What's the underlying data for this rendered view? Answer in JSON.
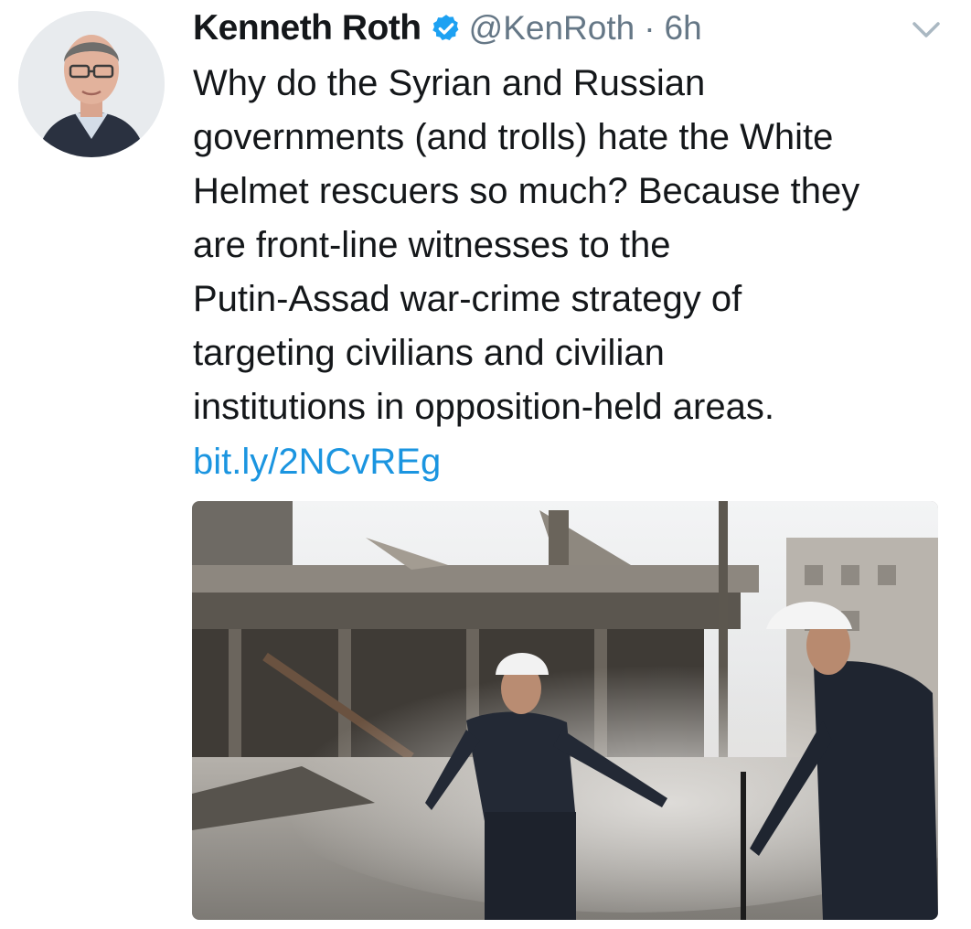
{
  "tweet": {
    "author_name": "Kenneth Roth",
    "handle": "@KenRoth",
    "separator": "·",
    "time": "6h",
    "verified": true,
    "text_lines": [
      "Why do the Syrian and Russian",
      "governments (and trolls) hate the White",
      "Helmet rescuers so much? Because they",
      "are front-line witnesses to the",
      "Putin-Assad war-crime strategy of",
      "targeting civilians and civilian",
      "institutions in opposition-held areas."
    ],
    "link": "bit.ly/2NCvREg"
  },
  "icons": {
    "verified": "verified-badge-icon",
    "menu": "chevron-down-icon"
  },
  "colors": {
    "text": "#14171a",
    "secondary": "#657786",
    "link": "#1b95e0",
    "verified": "#1da1f2"
  }
}
